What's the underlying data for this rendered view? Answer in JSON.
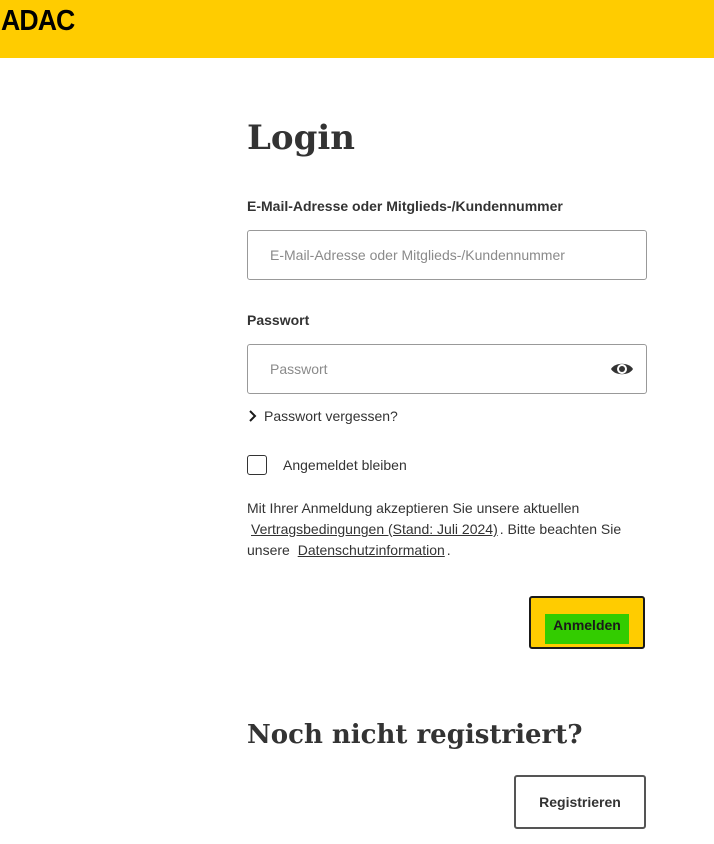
{
  "header": {
    "logo_text": "ADAC",
    "color": "#ffcc00"
  },
  "login": {
    "title": "Login",
    "email_label": "E-Mail-Adresse oder Mitglieds-/Kundennummer",
    "email_placeholder": "E-Mail-Adresse oder Mitglieds-/Kundennummer",
    "email_value": "",
    "password_label": "Passwort",
    "password_placeholder": "Passwort",
    "password_value": "",
    "password_toggle_icon": "eye-icon",
    "forgot_password": "Passwort vergessen?",
    "remember_me_label": "Angemeldet bleiben",
    "remember_me_checked": false,
    "terms_text_1": "Mit Ihrer Anmeldung akzeptieren Sie unsere aktuellen",
    "terms_link": "Vertragsbedingungen (Stand: Juli 2024)",
    "terms_text_2": ". Bitte beachten Sie unsere",
    "privacy_link": "Datenschutzinformation",
    "terms_text_3": ".",
    "submit_label": "Anmelden",
    "submit_color": "#ffcc00",
    "submit_highlight_color": "#33cc00"
  },
  "register": {
    "title": "Noch nicht registriert?",
    "button_label": "Registrieren"
  }
}
